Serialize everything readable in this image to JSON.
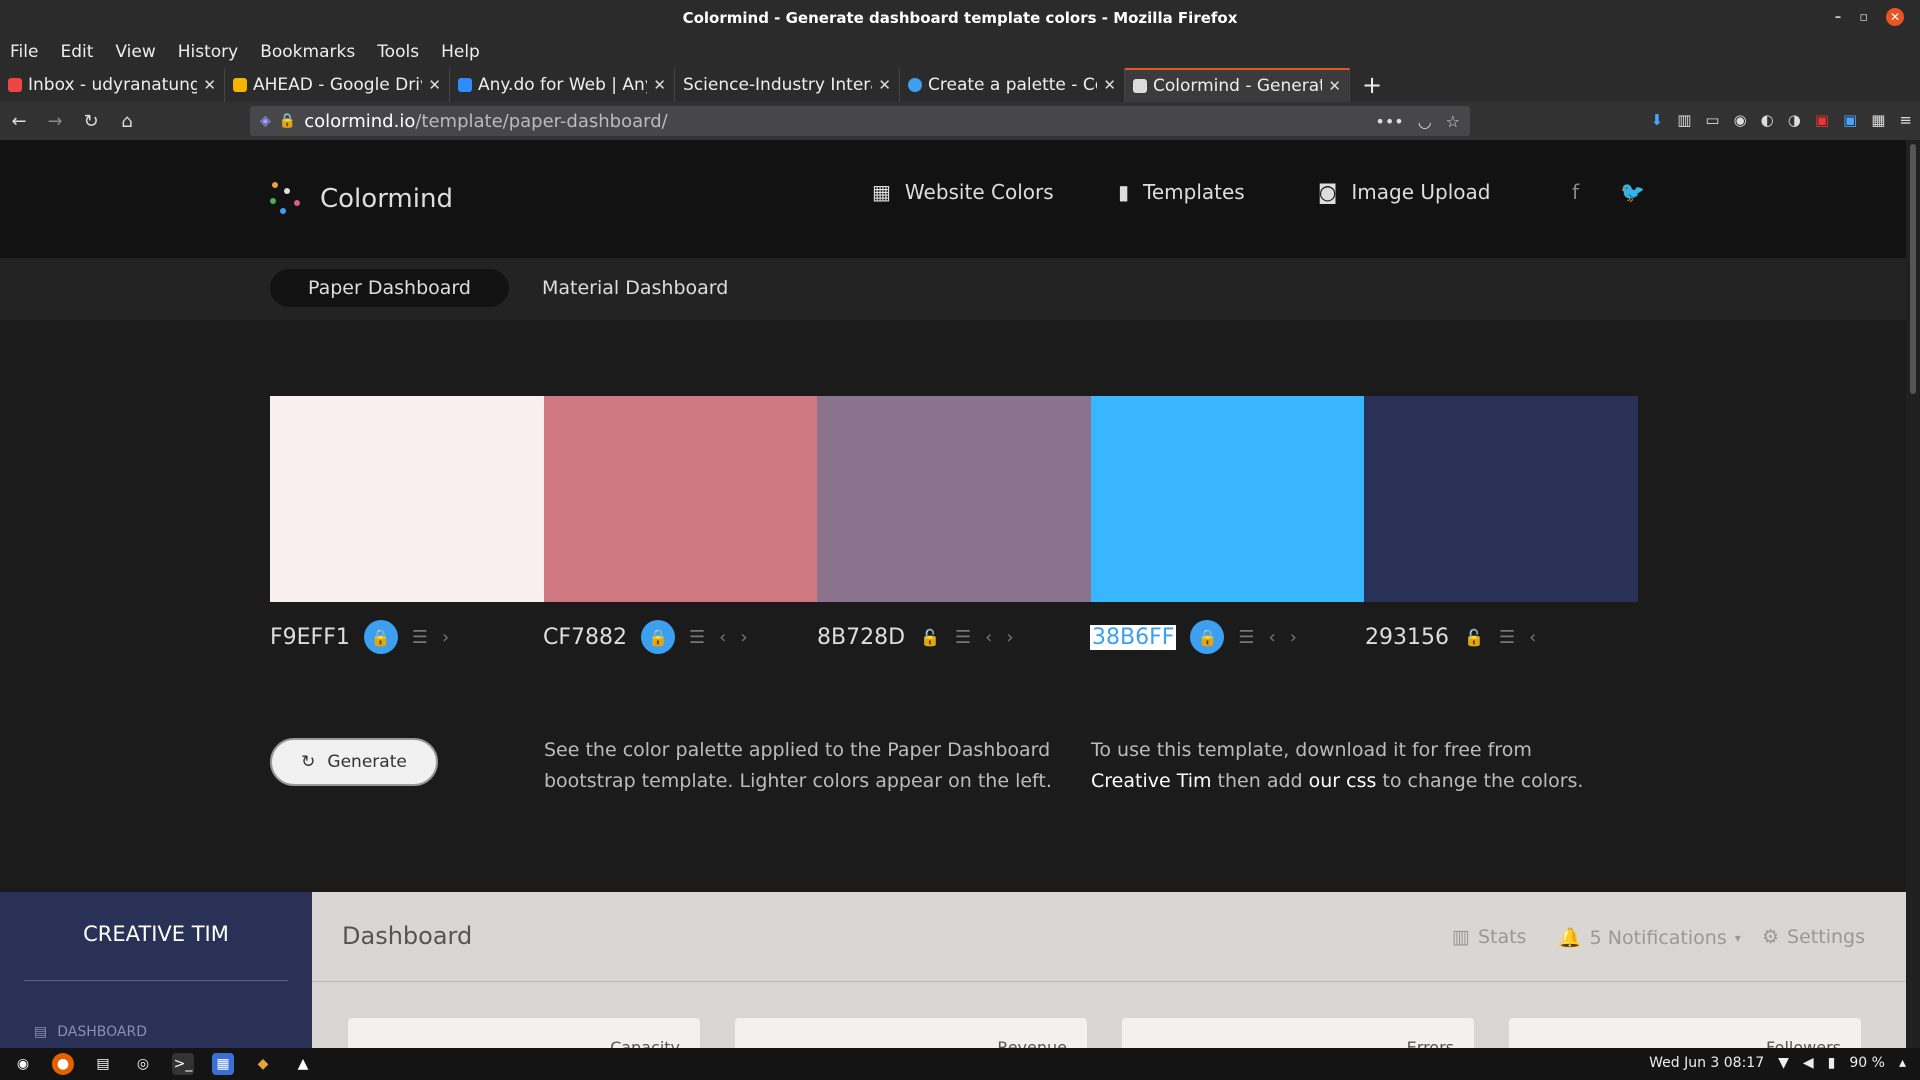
{
  "window": {
    "title": "Colormind - Generate dashboard template colors - Mozilla Firefox"
  },
  "menu": [
    "File",
    "Edit",
    "View",
    "History",
    "Bookmarks",
    "Tools",
    "Help"
  ],
  "tabs": [
    {
      "label": "Inbox - udyranatunga",
      "color": "#e44"
    },
    {
      "label": "AHEAD - Google Drive",
      "color": "#f4b400"
    },
    {
      "label": "Any.do for Web | Any",
      "color": "#2d8cff"
    },
    {
      "label": "Science-Industry Interac",
      "color": "#888"
    },
    {
      "label": "Create a palette - Co",
      "color": "#3d9ff0"
    },
    {
      "label": "Colormind - Generate",
      "color": "#ddd",
      "active": true
    }
  ],
  "url": {
    "host": "colormind.io",
    "path": "/template/paper-dashboard/"
  },
  "site": {
    "brand": "Colormind",
    "nav": [
      {
        "label": "Website Colors",
        "icon": "grid-icon"
      },
      {
        "label": "Templates",
        "icon": "bookmark-icon"
      },
      {
        "label": "Image Upload",
        "icon": "camera-icon"
      }
    ],
    "social": [
      "f",
      "facebook-icon",
      "twitter-icon"
    ]
  },
  "subnav": {
    "active": "Paper Dashboard",
    "other": "Material Dashboard"
  },
  "palette": [
    {
      "hex": "F9EFF1",
      "color": "#F9EFF1",
      "locked": true
    },
    {
      "hex": "CF7882",
      "color": "#CF7882",
      "locked": true
    },
    {
      "hex": "8B728D",
      "color": "#8B728D",
      "locked": false
    },
    {
      "hex": "38B6FF",
      "color": "#38B6FF",
      "locked": true
    },
    {
      "hex": "293156",
      "color": "#293156",
      "locked": false
    }
  ],
  "generate_label": "Generate",
  "desc1": {
    "line1": "See the color palette applied to the Paper Dashboard",
    "line2": "bootstrap template. Lighter colors appear on the left."
  },
  "desc2": {
    "line1": "To use this template, download it for free from",
    "link1": "Creative Tim",
    "mid": " then add ",
    "link2": "our css",
    "end": " to change the colors."
  },
  "preview": {
    "brand": "CREATIVE TIM",
    "side_item": "DASHBOARD",
    "title": "Dashboard",
    "menu": [
      {
        "label": "Stats",
        "icon": "stats-icon"
      },
      {
        "label": "5 Notifications",
        "icon": "bell-icon"
      },
      {
        "label": "Settings",
        "icon": "gear-icon"
      }
    ],
    "cards": [
      "Capacity",
      "Revenue",
      "Errors",
      "Followers"
    ]
  },
  "taskbar": {
    "clock": "Wed Jun 3  08:17",
    "battery": "90 %"
  }
}
